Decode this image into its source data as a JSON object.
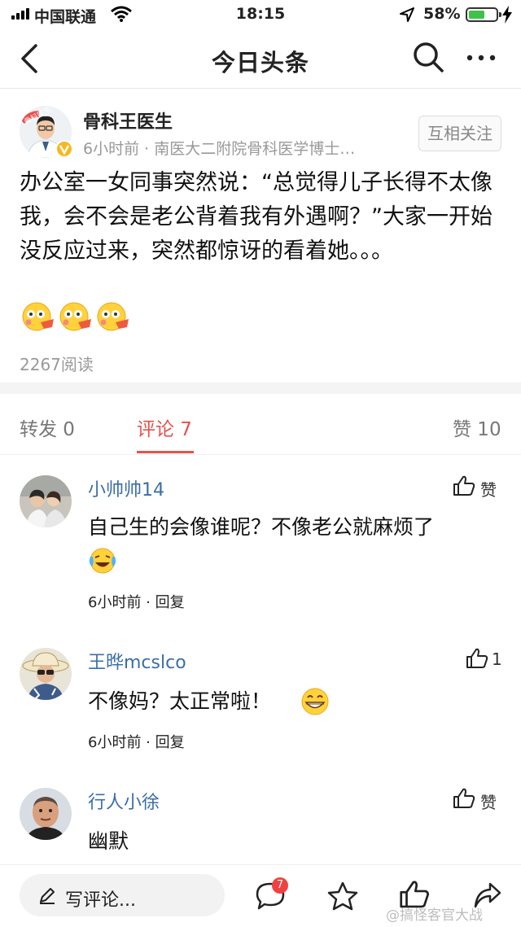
{
  "status_bar": {
    "carrier": "中国联通",
    "time": "18:15",
    "battery": "58%",
    "battery_level": 0.58
  },
  "nav": {
    "title": "今日头条"
  },
  "author": {
    "name": "骨科王医生",
    "meta": "6小时前 · 南医大二附院骨科医学博士…",
    "follow_label": "互相关注",
    "avatar_caption": "骨科医生"
  },
  "post": {
    "text": "办公室一女同事突然说：“总觉得儿子长得不太像我，会不会是老公背着我有外遇啊？”大家一开始没反应过来，突然都惊讶的看着她。。。",
    "reads": "2267阅读"
  },
  "tabs": {
    "share": "转发 0",
    "comment": "评论 7",
    "like": "赞 10"
  },
  "comments": [
    {
      "name": "小帅帅14",
      "text": "自己生的会像谁呢？不像老公就麻烦了",
      "meta": "6小时前 · 回复",
      "likes": "赞"
    },
    {
      "name": "王晔mcslco",
      "text": "不像妈？太正常啦！",
      "meta": "6小时前 · 回复",
      "likes": "1"
    },
    {
      "name": "行人小徐",
      "text": "幽默",
      "likes": "赞"
    }
  ],
  "bottom": {
    "write_label": "写评论...",
    "comment_badge": "7"
  },
  "watermark": "@搞怪客官大战",
  "colors": {
    "accent": "#e8504c",
    "link": "#3b6ea8",
    "battery": "#3fc24a",
    "badge": "#f04141"
  },
  "icons": [
    "signal-icon",
    "wifi-icon",
    "location-icon",
    "battery-icon",
    "back-icon",
    "search-icon",
    "more-icon",
    "verified-icon",
    "flushed-emoji-icon",
    "thumb-up-icon",
    "laughing-emoji-icon",
    "grin-emoji-icon",
    "pen-icon",
    "comment-icon",
    "star-icon",
    "share-icon"
  ]
}
